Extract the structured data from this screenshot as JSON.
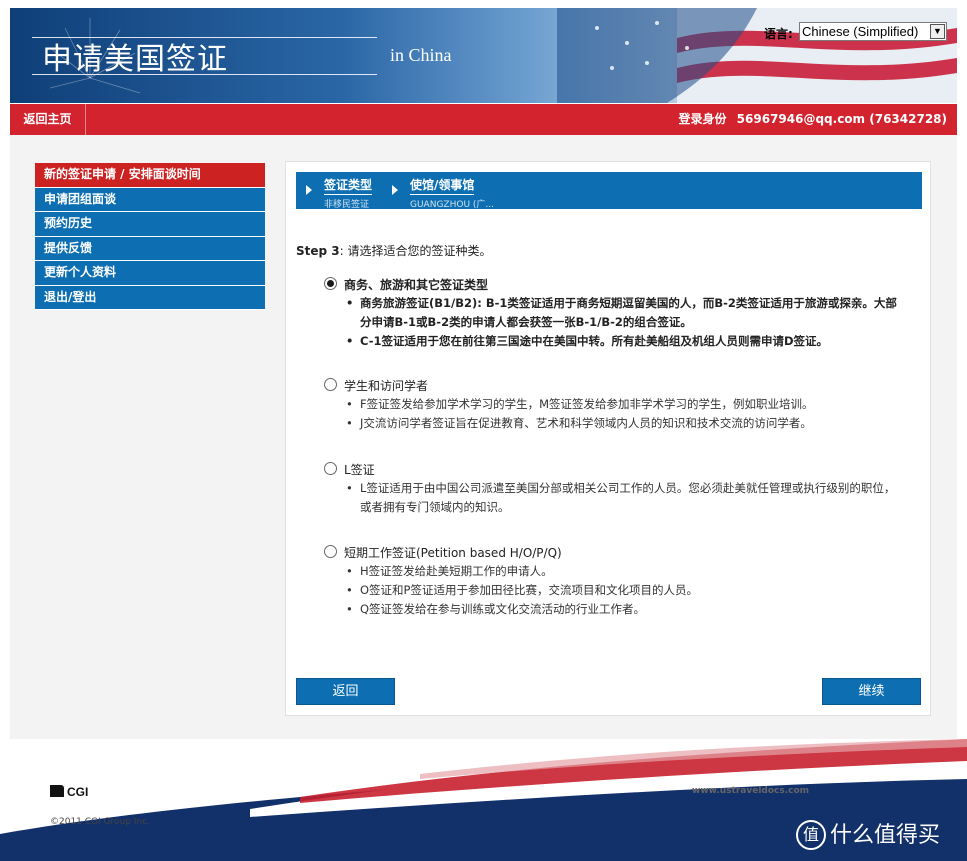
{
  "header": {
    "site_title": "申请美国签证",
    "location": "in China",
    "language_label": "语言:",
    "language_selected": "Chinese (Simplified)"
  },
  "navbar": {
    "home_label": "返回主页",
    "login_label": "登录身份",
    "login_value": "56967946@qq.com (76342728)"
  },
  "sidebar": {
    "items": [
      {
        "label": "新的签证申请 / 安排面谈时间",
        "active": true
      },
      {
        "label": "申请团组面谈"
      },
      {
        "label": "预约历史"
      },
      {
        "label": "提供反馈"
      },
      {
        "label": "更新个人资料"
      },
      {
        "label": "退出/登出"
      }
    ]
  },
  "breadcrumbs": [
    {
      "title": "签证类型",
      "sub": "非移民签证"
    },
    {
      "title": "使馆/领事馆",
      "sub": "GUANGZHOU (广..."
    }
  ],
  "step": {
    "label": "Step 3",
    "text": ": 请选择适合您的签证种类。"
  },
  "options": [
    {
      "title": "商务、旅游和其它签证类型",
      "checked": true,
      "bullets": [
        "商务旅游签证(B1/B2): B-1类签证适用于商务短期逗留美国的人，而B-2类签证适用于旅游或探亲。大部分申请B-1或B-2类的申请人都会获签一张B-1/B-2的组合签证。",
        "C-1签证适用于您在前往第三国途中在美国中转。所有赴美船组及机组人员则需申请D签证。"
      ]
    },
    {
      "title": "学生和访问学者",
      "checked": false,
      "bullets": [
        "F签证签发给参加学术学习的学生，M签证签发给参加非学术学习的学生，例如职业培训。",
        "J交流访问学者签证旨在促进教育、艺术和科学领域内人员的知识和技术交流的访问学者。"
      ]
    },
    {
      "title": "L签证",
      "checked": false,
      "bullets": [
        "L签证适用于由中国公司派遣至美国分部或相关公司工作的人员。您必须赴美就任管理或执行级别的职位，或者拥有专门领域内的知识。"
      ]
    },
    {
      "title": "短期工作签证(Petition based H/O/P/Q)",
      "checked": false,
      "bullets": [
        "H签证签发给赴美短期工作的申请人。",
        "O签证和P签证适用于参加田径比赛，交流项目和文化项目的人员。",
        "Q签证签发给在参与训练或文化交流活动的行业工作者。"
      ]
    }
  ],
  "buttons": {
    "back": "返回",
    "next": "继续"
  },
  "footer": {
    "logo": "CGI",
    "copyright": "©2011 CGI Group Inc.",
    "url": "www.ustraveldocs.com",
    "watermark": "什么值得买",
    "watermark_icon": "值"
  },
  "colors": {
    "nav_blue": "#0d6fb2",
    "nav_red": "#d2232e",
    "active_red": "#cc2222"
  }
}
